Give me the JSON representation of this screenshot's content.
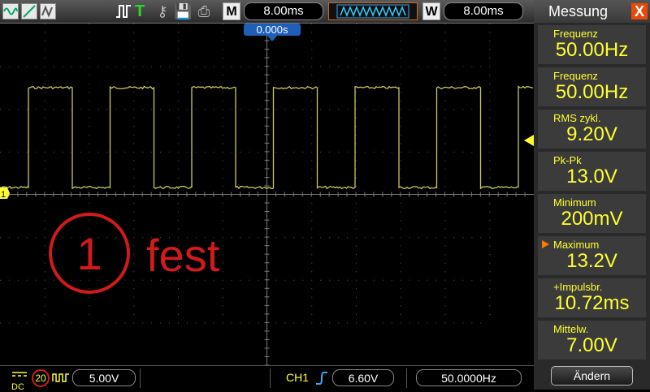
{
  "topbar": {
    "mode_m": "M",
    "timebase": "8.00ms",
    "mode_w": "W",
    "window_timebase": "8.00ms",
    "trigger_mode": "T"
  },
  "screen": {
    "trigger_offset": "0.000s",
    "ch1_marker": "1",
    "annotation_number": "1",
    "annotation_text": "fest",
    "signal_color": "#c8c864",
    "annotation_color": "#d11b1b"
  },
  "panel": {
    "title": "Messung",
    "close": "X",
    "items": [
      {
        "label": "Frequenz",
        "value": "50.00Hz"
      },
      {
        "label": "Frequenz",
        "value": "50.00Hz"
      },
      {
        "label": "RMS  zykl.",
        "value": "9.20V"
      },
      {
        "label": "Pk-Pk",
        "value": "13.0V"
      },
      {
        "label": "Minimum",
        "value": "200mV"
      },
      {
        "label": "Maximum",
        "value": "13.2V"
      },
      {
        "label": "+Impulsbr.",
        "value": "10.72ms"
      },
      {
        "label": "Mittelw.",
        "value": "7.00V"
      }
    ],
    "change_button": "Ändern"
  },
  "bottombar": {
    "coupling": "DC",
    "probe": "20",
    "ch1_scale": "5.00V",
    "trigger_source": "CH1",
    "trigger_level": "6.60V",
    "trigger_freq": "50.0000Hz"
  }
}
